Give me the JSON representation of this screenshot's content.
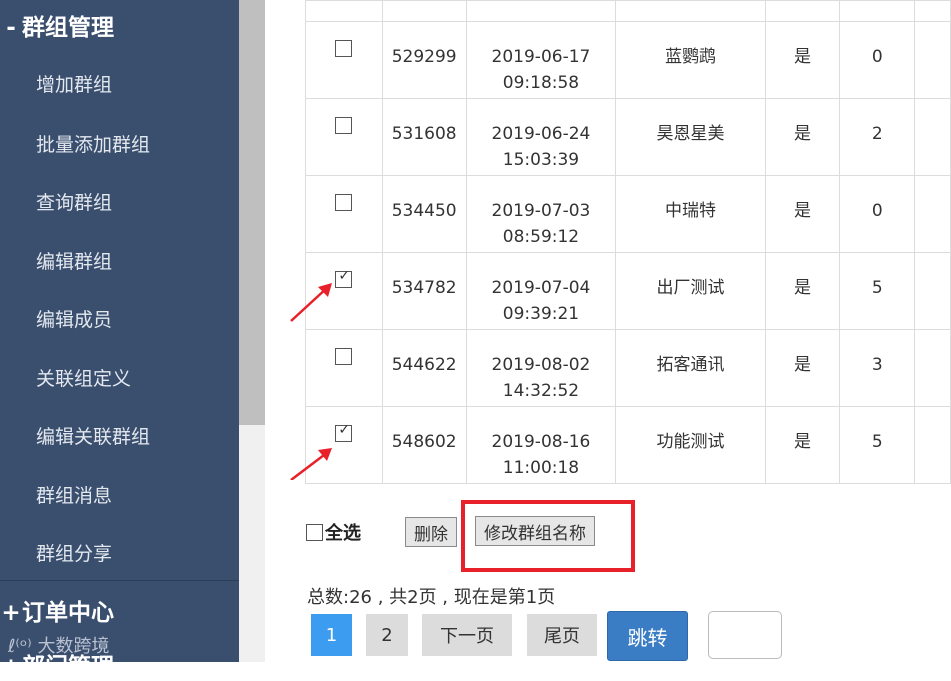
{
  "sidebar": {
    "group_section": {
      "sign": "-",
      "title": "群组管理"
    },
    "items": [
      {
        "label": "增加群组"
      },
      {
        "label": "批量添加群组"
      },
      {
        "label": "查询群组"
      },
      {
        "label": "编辑群组"
      },
      {
        "label": "编辑成员"
      },
      {
        "label": "关联组定义"
      },
      {
        "label": "编辑关联群组"
      },
      {
        "label": "群组消息"
      },
      {
        "label": "群组分享"
      }
    ],
    "order_section": {
      "sign": "+",
      "title": "订单中心"
    },
    "partial_section": {
      "sign": "+",
      "title": "部门管理"
    },
    "watermark": "大数跨境"
  },
  "table": {
    "rows": [
      {
        "checked": false,
        "id": "529299",
        "date": "2019-06-17",
        "time": "09:18:58",
        "name": "蓝鹦鹉",
        "flag": "是",
        "count": "0"
      },
      {
        "checked": false,
        "id": "531608",
        "date": "2019-06-24",
        "time": "15:03:39",
        "name": "昊恩星美",
        "flag": "是",
        "count": "2"
      },
      {
        "checked": false,
        "id": "534450",
        "date": "2019-07-03",
        "time": "08:59:12",
        "name": "中瑞特",
        "flag": "是",
        "count": "0"
      },
      {
        "checked": true,
        "id": "534782",
        "date": "2019-07-04",
        "time": "09:39:21",
        "name": "出厂测试",
        "flag": "是",
        "count": "5"
      },
      {
        "checked": false,
        "id": "544622",
        "date": "2019-08-02",
        "time": "14:32:52",
        "name": "拓客通讯",
        "flag": "是",
        "count": "3"
      },
      {
        "checked": true,
        "id": "548602",
        "date": "2019-08-16",
        "time": "11:00:18",
        "name": "功能测试",
        "flag": "是",
        "count": "5"
      }
    ]
  },
  "controls": {
    "select_all": "全选",
    "delete": "删除",
    "rename": "修改群组名称"
  },
  "pagination": {
    "summary": "总数:26 , 共2页 , 现在是第1页",
    "pages": [
      "1",
      "2"
    ],
    "next": "下一页",
    "last": "尾页",
    "jump": "跳转",
    "input_value": ""
  },
  "colors": {
    "sidebar_bg": "#3a4e6e",
    "highlight": "#e8202a",
    "active_page": "#3b9cf0",
    "jump_button": "#3b7dc4"
  }
}
